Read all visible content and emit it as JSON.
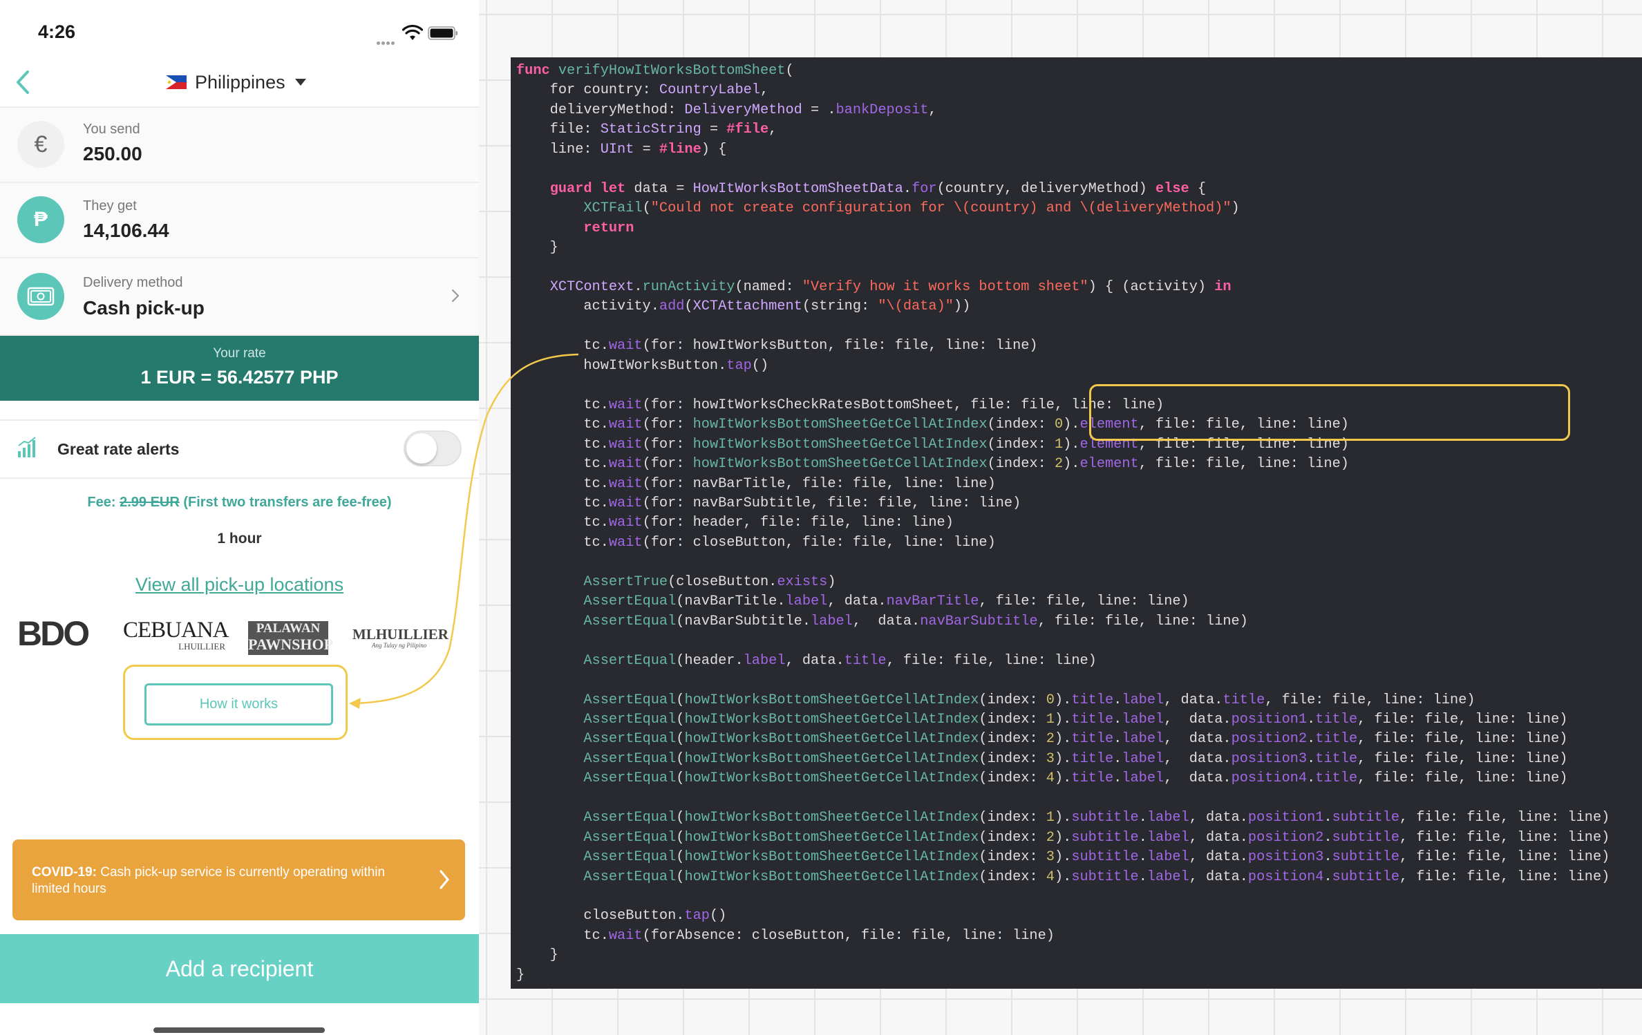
{
  "status_bar": {
    "time": "4:26"
  },
  "navbar": {
    "country": "Philippines"
  },
  "send": {
    "label": "You send",
    "value": "250.00",
    "currency_symbol": "€"
  },
  "get": {
    "label": "They get",
    "value": "14,106.44",
    "currency_symbol": "₱"
  },
  "delivery": {
    "label": "Delivery method",
    "value": "Cash pick-up"
  },
  "rate": {
    "label": "Your rate",
    "value": "1 EUR = 56.42577 PHP"
  },
  "alerts": {
    "label": "Great rate alerts",
    "enabled": false
  },
  "fee": {
    "prefix": "Fee:",
    "old_fee": "2.99 EUR",
    "note": "(First two transfers are fee-free)"
  },
  "delivery_time": "1 hour",
  "locations_link": "View all pick-up locations",
  "partners": [
    {
      "name": "BDO"
    },
    {
      "name": "CEBUANA",
      "sub": "LHUILLIER"
    },
    {
      "name": "PALAWAN",
      "sub": "PAWNSHOP"
    },
    {
      "name": "MLHUILLIER",
      "sub": "Ang Tulay ng Pilipino"
    }
  ],
  "how_it_works_button": "How it works",
  "covid": {
    "prefix": "COVID-19:",
    "message": "Cash pick-up service is currently operating within limited hours"
  },
  "add_recipient_button": "Add a recipient",
  "colors": {
    "accent": "#5cc7b8",
    "rate_bar": "#257a6d",
    "covid_banner": "#eaa43d",
    "highlight": "#f2c94c",
    "code_background": "#292a30"
  },
  "code_lines": [
    "func verifyHowItWorksBottomSheet(",
    "    for country: CountryLabel,",
    "    deliveryMethod: DeliveryMethod = .bankDeposit,",
    "    file: StaticString = #file,",
    "    line: UInt = #line) {",
    "",
    "    guard let data = HowItWorksBottomSheetData.for(country, deliveryMethod) else {",
    "        XCTFail(\"Could not create configuration for \\(country) and \\(deliveryMethod)\")",
    "        return",
    "    }",
    "",
    "    XCTContext.runActivity(named: \"Verify how it works bottom sheet\") { (activity) in",
    "        activity.add(XCTAttachment(string: \"\\(data)\"))",
    "",
    "        tc.wait(for: howItWorksButton, file: file, line: line)",
    "        howItWorksButton.tap()",
    "",
    "        tc.wait(for: howItWorksCheckRatesBottomSheet, file: file, line: line)",
    "        tc.wait(for: howItWorksBottomSheetGetCellAtIndex(index: 0).element, file: file, line: line)",
    "        tc.wait(for: howItWorksBottomSheetGetCellAtIndex(index: 1).element, file: file, line: line)",
    "        tc.wait(for: howItWorksBottomSheetGetCellAtIndex(index: 2).element, file: file, line: line)",
    "        tc.wait(for: navBarTitle, file: file, line: line)",
    "        tc.wait(for: navBarSubtitle, file: file, line: line)",
    "        tc.wait(for: header, file: file, line: line)",
    "        tc.wait(for: closeButton, file: file, line: line)",
    "",
    "        AssertTrue(closeButton.exists)",
    "        AssertEqual(navBarTitle.label, data.navBarTitle, file: file, line: line)",
    "        AssertEqual(navBarSubtitle.label,  data.navBarSubtitle, file: file, line: line)",
    "",
    "        AssertEqual(header.label, data.title, file: file, line: line)",
    "",
    "        AssertEqual(howItWorksBottomSheetGetCellAtIndex(index: 0).title.label, data.title, file: file, line: line)",
    "        AssertEqual(howItWorksBottomSheetGetCellAtIndex(index: 1).title.label,  data.position1.title, file: file, line: line)",
    "        AssertEqual(howItWorksBottomSheetGetCellAtIndex(index: 2).title.label,  data.position2.title, file: file, line: line)",
    "        AssertEqual(howItWorksBottomSheetGetCellAtIndex(index: 3).title.label,  data.position3.title, file: file, line: line)",
    "        AssertEqual(howItWorksBottomSheetGetCellAtIndex(index: 4).title.label,  data.position4.title, file: file, line: line)",
    "",
    "        AssertEqual(howItWorksBottomSheetGetCellAtIndex(index: 1).subtitle.label, data.position1.subtitle, file: file, line: line)",
    "        AssertEqual(howItWorksBottomSheetGetCellAtIndex(index: 2).subtitle.label, data.position2.subtitle, file: file, line: line)",
    "        AssertEqual(howItWorksBottomSheetGetCellAtIndex(index: 3).subtitle.label, data.position3.subtitle, file: file, line: line)",
    "        AssertEqual(howItWorksBottomSheetGetCellAtIndex(index: 4).subtitle.label, data.position4.subtitle, file: file, line: line)",
    "",
    "        closeButton.tap()",
    "        tc.wait(forAbsence: closeButton, file: file, line: line)",
    "    }",
    "}"
  ]
}
